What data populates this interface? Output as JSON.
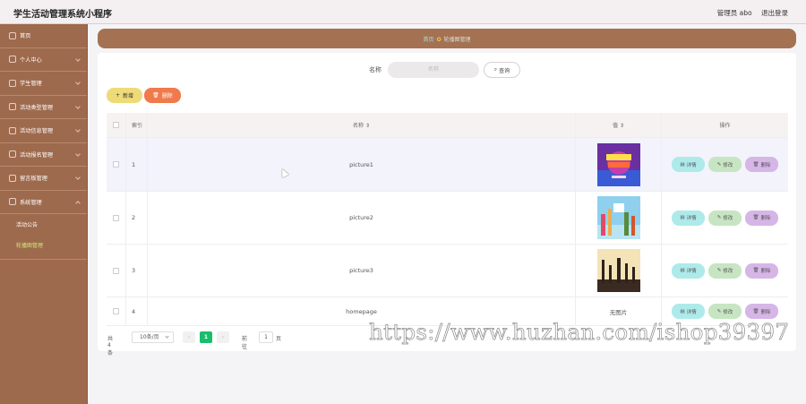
{
  "header": {
    "app_title": "学生活动管理系统小程序",
    "user_label": "管理员 abo",
    "logout_label": "退出登录"
  },
  "sidebar": {
    "items": [
      {
        "label": "首页",
        "icon": "home-icon"
      },
      {
        "label": "个人中心",
        "icon": "user-icon"
      },
      {
        "label": "学生管理",
        "icon": "student-icon"
      },
      {
        "label": "活动类型管理",
        "icon": "category-icon"
      },
      {
        "label": "活动信息管理",
        "icon": "info-icon"
      },
      {
        "label": "活动报名管理",
        "icon": "signup-icon"
      },
      {
        "label": "留言板管理",
        "icon": "message-icon"
      },
      {
        "label": "系统管理",
        "icon": "system-icon"
      }
    ],
    "sub_items": [
      {
        "label": "活动公告"
      },
      {
        "label": "轮播图管理"
      }
    ]
  },
  "breadcrumb": {
    "home": "首页",
    "current": "轮播图管理"
  },
  "search": {
    "label": "名称",
    "placeholder": "名称",
    "button_label": "查询"
  },
  "toolbar": {
    "add_label": "新增",
    "delete_label": "删除"
  },
  "table": {
    "columns": {
      "index": "索引",
      "name": "名称 ⇕",
      "value": "值 ⇕",
      "ops": "操作"
    },
    "rows": [
      {
        "index": "1",
        "name": "picture1",
        "value": "",
        "image": "poster-purple"
      },
      {
        "index": "2",
        "name": "picture2",
        "value": "",
        "image": "poster-sky"
      },
      {
        "index": "3",
        "name": "picture3",
        "value": "",
        "image": "poster-silhouette"
      },
      {
        "index": "4",
        "name": "homepage",
        "value": "无图片",
        "image": ""
      }
    ],
    "op_labels": {
      "detail": "详情",
      "edit": "修改",
      "delete": "删除"
    }
  },
  "pagination": {
    "total": "共 4 条",
    "page_size": "10条/页",
    "current_page": "1",
    "goto_label": "前往",
    "goto_value": "1",
    "page_suffix": "页"
  },
  "overlay": {
    "watermark": "https://www.huzhan.com/ishop39397"
  },
  "colors": {
    "sidebar": "#9e6a4d",
    "breadcrumb_bar": "#a47252",
    "add_button": "#eedb78",
    "delete_button": "#f07a4b",
    "detail_button": "#aeeaea",
    "edit_button": "#c7e5c2",
    "row_delete_button": "#d6b6e6",
    "pager_active": "#19be6b"
  }
}
